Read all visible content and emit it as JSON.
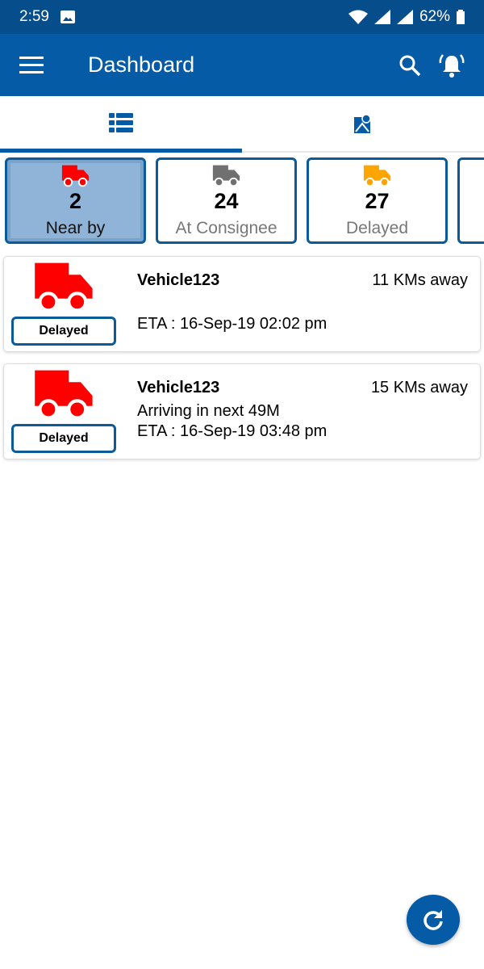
{
  "status_bar": {
    "time": "2:59",
    "battery": "62%"
  },
  "app_bar": {
    "title": "Dashboard"
  },
  "tabs": [
    {
      "icon": "list-icon",
      "active": true
    },
    {
      "icon": "map-pin-icon",
      "active": false
    }
  ],
  "filters": [
    {
      "count": "2",
      "label": "Near by",
      "color": "#ff0000",
      "selected": true
    },
    {
      "count": "24",
      "label": "At Consignee",
      "color": "#707070",
      "selected": false
    },
    {
      "count": "27",
      "label": "Delayed",
      "color": "#ffa500",
      "selected": false
    }
  ],
  "vehicles": [
    {
      "name": "Vehicle123",
      "distance": "11 KMs away",
      "arrival": "",
      "eta": "ETA : 16-Sep-19 02:02 pm",
      "status": "Delayed"
    },
    {
      "name": "Vehicle123",
      "distance": "15 KMs away",
      "arrival": "Arriving in next 49M",
      "eta": "ETA : 16-Sep-19 03:48 pm",
      "status": "Delayed"
    }
  ],
  "colors": {
    "primary": "#065ba6",
    "status_bar": "#064e8b",
    "alert": "#ff0000"
  }
}
